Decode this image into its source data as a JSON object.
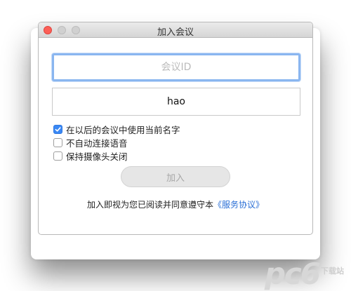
{
  "window": {
    "title": "加入会议"
  },
  "form": {
    "meeting_id_placeholder": "会议ID",
    "meeting_id_value": "",
    "name_value": "hao"
  },
  "options": [
    {
      "label": "在以后的会议中使用当前名字",
      "checked": true
    },
    {
      "label": "不自动连接语音",
      "checked": false
    },
    {
      "label": "保持摄像头关闭",
      "checked": false
    }
  ],
  "join_button": {
    "label": "加入",
    "enabled": false
  },
  "agreement": {
    "prefix": "加入即视为您已阅读并同意遵守本",
    "link_text": "《服务协议》"
  },
  "watermark": {
    "logo": "pc6",
    "sub": "下载站"
  },
  "colors": {
    "accent": "#3a88f5",
    "link": "#2a6fd6",
    "focus_ring": "#8ab6f0",
    "close_button": "#fc5f57"
  }
}
